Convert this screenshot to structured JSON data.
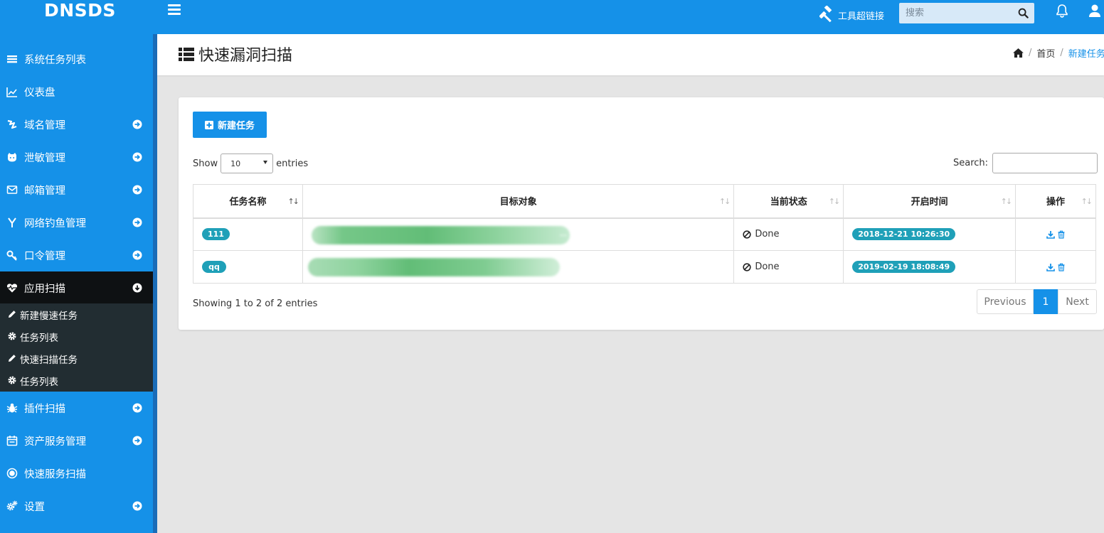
{
  "app": {
    "brand": "DNSDS"
  },
  "topbar": {
    "tool_link": "工具超链接",
    "search_placeholder": "搜索"
  },
  "sidebar": {
    "items": [
      {
        "label": "系统任务列表",
        "icon": "list-icon"
      },
      {
        "label": "仪表盘",
        "icon": "line-chart-icon"
      },
      {
        "label": "域名管理",
        "icon": "map-icon"
      },
      {
        "label": "泄敏管理",
        "icon": "github-icon"
      },
      {
        "label": "邮箱管理",
        "icon": "envelope-icon"
      },
      {
        "label": "网络钓鱼管理",
        "icon": "y-icon"
      },
      {
        "label": "口令管理",
        "icon": "key-icon"
      },
      {
        "label": "应用扫描",
        "icon": "heartbeat-icon",
        "active": true
      },
      {
        "label": "插件扫描",
        "icon": "bug-icon"
      },
      {
        "label": "资产服务管理",
        "icon": "calendar-icon"
      },
      {
        "label": "快速服务扫描",
        "icon": "dot-circle-icon"
      },
      {
        "label": "设置",
        "icon": "cogs-icon"
      }
    ],
    "submenu": [
      {
        "label": "新建慢速任务",
        "icon": "pencil-icon"
      },
      {
        "label": "任务列表",
        "icon": "gear-icon"
      },
      {
        "label": "快速扫描任务",
        "icon": "pencil-icon"
      },
      {
        "label": "任务列表",
        "icon": "gear-icon"
      }
    ]
  },
  "header": {
    "title": "快速漏洞扫描",
    "breadcrumb": {
      "home": "首页",
      "current": "新建任务"
    }
  },
  "box": {
    "new_button": "新建任务",
    "length": {
      "show": "Show",
      "value": "10",
      "entries": "entries"
    },
    "search_label": "Search:",
    "columns": [
      "任务名称",
      "目标对象",
      "当前状态",
      "开启时间",
      "操作"
    ],
    "rows": [
      {
        "name": "111",
        "status": "Done",
        "time": "2018-12-21 10:26:30"
      },
      {
        "name": "qq",
        "status": "Done",
        "time": "2019-02-19 18:08:49"
      }
    ],
    "info": "Showing 1 to 2 of 2 entries",
    "pager": {
      "previous": "Previous",
      "page": "1",
      "next": "Next"
    }
  },
  "colors": {
    "primary": "#1591e8",
    "badge": "#1fa0b8",
    "active_nav": "#0e1113",
    "submenu": "#222d32"
  }
}
